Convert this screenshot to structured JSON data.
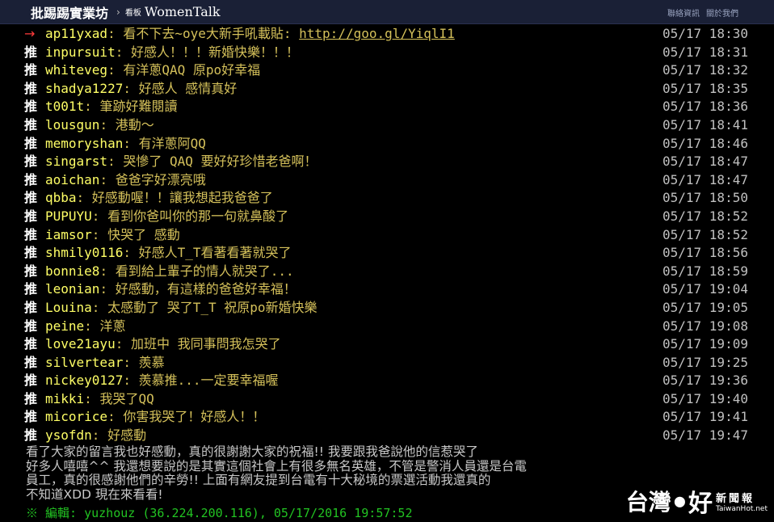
{
  "header": {
    "site_name": "批踢踢實業坊",
    "separator": "›",
    "board_label": "看板",
    "board_name": "WomenTalk",
    "links": [
      "聯絡資訊",
      "關於我們"
    ]
  },
  "comments": [
    {
      "tag": "→",
      "user": "ap11yxad",
      "msg": "看不下去~oye大新手吼載貼: ",
      "link": "http://goo.gl/YiqlI1",
      "time": "05/17 18:30"
    },
    {
      "tag": "推",
      "user": "inpursuit",
      "msg": "好感人！！！新婚快樂！！！",
      "time": "05/17 18:31"
    },
    {
      "tag": "推",
      "user": "whiteveg",
      "msg": "有洋蔥QAQ 原po好幸福",
      "time": "05/17 18:32"
    },
    {
      "tag": "推",
      "user": "shadya1227",
      "msg": "好感人 感情真好",
      "time": "05/17 18:35"
    },
    {
      "tag": "推",
      "user": "t001t",
      "msg": "筆跡好難閱讀",
      "time": "05/17 18:36"
    },
    {
      "tag": "推",
      "user": "lousgun",
      "msg": "港動～",
      "time": "05/17 18:41"
    },
    {
      "tag": "推",
      "user": "memoryshan",
      "msg": "有洋蔥阿QQ",
      "time": "05/17 18:46"
    },
    {
      "tag": "推",
      "user": "singarst",
      "msg": "哭慘了 QAQ 要好好珍惜老爸啊！",
      "time": "05/17 18:47"
    },
    {
      "tag": "推",
      "user": "aoichan",
      "msg": "爸爸字好漂亮哦",
      "time": "05/17 18:47"
    },
    {
      "tag": "推",
      "user": "qbba",
      "msg": "好感動喔！！讓我想起我爸爸了",
      "time": "05/17 18:50"
    },
    {
      "tag": "推",
      "user": "PUPUYU",
      "msg": "看到你爸叫你的那一句就鼻酸了",
      "time": "05/17 18:52"
    },
    {
      "tag": "推",
      "user": "iamsor",
      "msg": "快哭了 感動",
      "time": "05/17 18:52"
    },
    {
      "tag": "推",
      "user": "shmily0116",
      "msg": "好感人T_T看著看著就哭了",
      "time": "05/17 18:56"
    },
    {
      "tag": "推",
      "user": "bonnie8",
      "msg": "看到給上輩子的情人就哭了...",
      "time": "05/17 18:59"
    },
    {
      "tag": "推",
      "user": "leonian",
      "msg": "好感動，有這樣的爸爸好幸福！",
      "time": "05/17 19:04"
    },
    {
      "tag": "推",
      "user": "Louina",
      "msg": "太感動了 哭了T_T 祝原po新婚快樂",
      "time": "05/17 19:05"
    },
    {
      "tag": "推",
      "user": "peine",
      "msg": "洋蔥",
      "time": "05/17 19:08"
    },
    {
      "tag": "推",
      "user": "love21ayu",
      "msg": "加班中 我同事問我怎哭了",
      "time": "05/17 19:09"
    },
    {
      "tag": "推",
      "user": "silvertear",
      "msg": "羨慕",
      "time": "05/17 19:25"
    },
    {
      "tag": "推",
      "user": "nickey0127",
      "msg": "羨慕推...一定要幸福喔",
      "time": "05/17 19:36"
    },
    {
      "tag": "推",
      "user": "mikki",
      "msg": "我哭了QQ",
      "time": "05/17 19:40"
    },
    {
      "tag": "推",
      "user": "micorice",
      "msg": "你害我哭了！好感人！！",
      "time": "05/17 19:41"
    },
    {
      "tag": "推",
      "user": "ysofdn",
      "msg": "好感動",
      "time": "05/17 19:47"
    }
  ],
  "post": {
    "lines": [
      "看了大家的留言我也好感動，真的很謝謝大家的祝福!! 我要跟我爸說他的信惹哭了",
      "好多人嘻嘻^^ 我還想要說的是其實這個社會上有很多無名英雄，不管是警消人員還是台電",
      "員工，真的很感謝他們的辛勞!! 上面有網友提到台電有十大秘境的票選活動我還真的",
      "不知道XDD 現在來看看!"
    ],
    "edit": "※ 編輯: yuzhouz (36.224.200.116), 05/17/2016 19:57:52"
  },
  "watermark": {
    "main": "台灣",
    "dot": "●",
    "hao": "好",
    "news": "新聞報",
    "url": "TaiwanHot.net"
  }
}
